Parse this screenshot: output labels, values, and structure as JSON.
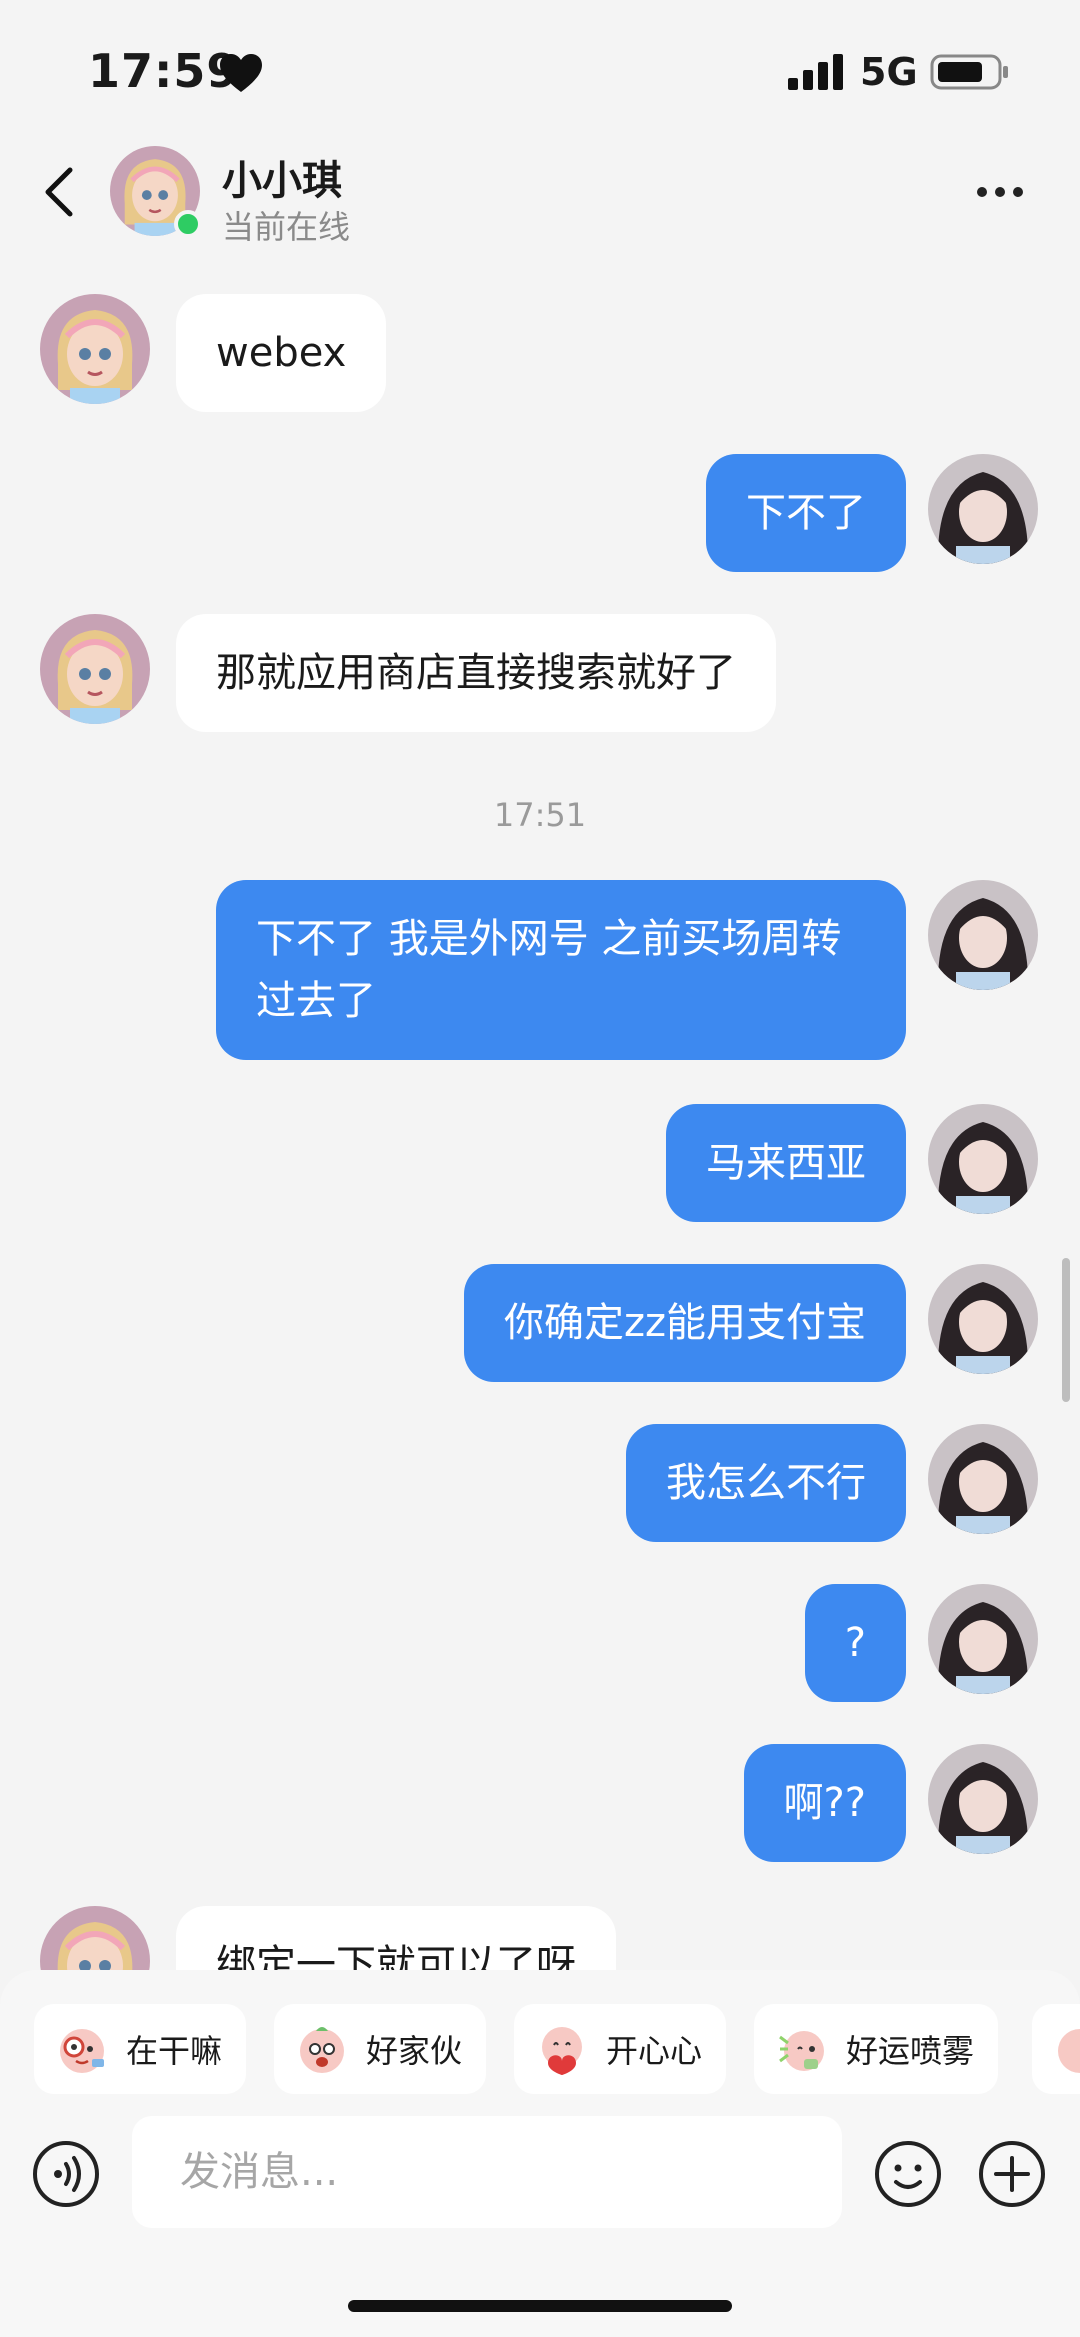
{
  "status_bar": {
    "time": "17:59",
    "network": "5G"
  },
  "header": {
    "name": "小小琪",
    "status": "当前在线"
  },
  "messages": {
    "m1": "webex",
    "m2": "下不了",
    "m3": "那就应用商店直接搜索就好了",
    "time_divider": "17:51",
    "m4": "下不了 我是外网号 之前买场周转过去了",
    "m5": "马来西亚",
    "m6": "你确定zz能用支付宝",
    "m7": "我怎么不行",
    "m8": "?",
    "m9": "啊??",
    "m10": "绑定一下就可以了呀"
  },
  "quick_replies": [
    "在干嘛",
    "好家伙",
    "开心心",
    "好运喷雾"
  ],
  "input": {
    "placeholder": "发消息..."
  },
  "colors": {
    "outgoing_bubble": "#3d89f0",
    "online_dot": "#2ecc63"
  }
}
